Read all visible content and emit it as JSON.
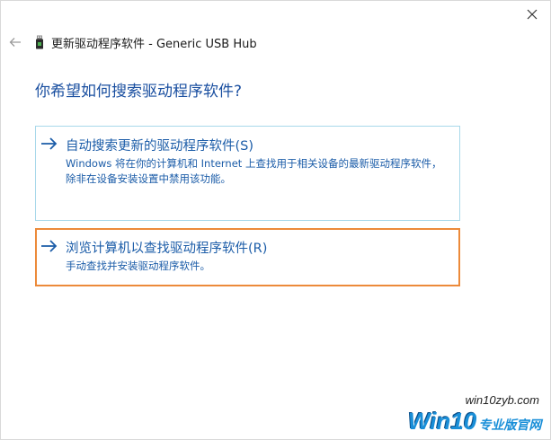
{
  "window": {
    "title": "更新驱动程序软件 - Generic USB Hub"
  },
  "question": "你希望如何搜索驱动程序软件?",
  "options": [
    {
      "title": "自动搜索更新的驱动程序软件(S)",
      "description": "Windows 将在你的计算机和 Internet 上查找用于相关设备的最新驱动程序软件，除非在设备安装设置中禁用该功能。"
    },
    {
      "title": "浏览计算机以查找驱动程序软件(R)",
      "description": "手动查找并安装驱动程序软件。"
    }
  ],
  "watermark": {
    "url": "win10zyb.com",
    "brand_main": "Win10",
    "brand_sub": "专业版官网"
  },
  "colors": {
    "accent_link": "#1b5ca8",
    "question": "#1a4fa0",
    "highlight_border": "#ec8a3a",
    "option_border": "#a8d8ea"
  },
  "icons": {
    "close": "close-icon",
    "back": "back-arrow-icon",
    "header": "usb-device-icon",
    "option_arrow": "arrow-right-icon"
  }
}
